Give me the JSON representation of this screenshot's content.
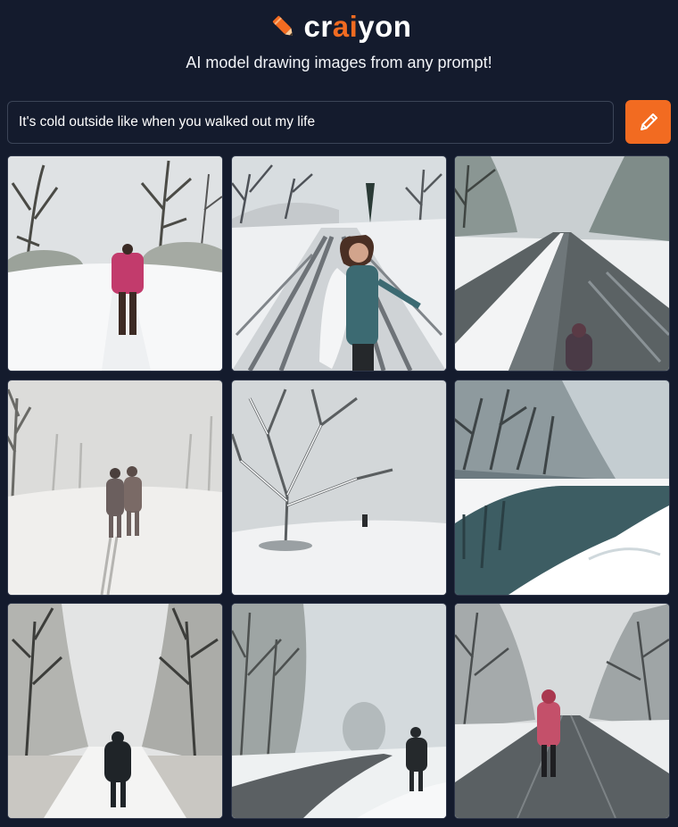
{
  "brand": {
    "name_pre": "cr",
    "name_accent": "ai",
    "name_post": "yon",
    "tagline": "AI model drawing images from any prompt!",
    "accent_color": "#f26b21",
    "logo_icon": "crayon-pencil-icon"
  },
  "prompt": {
    "value": "It's cold outside like when you walked out my life",
    "placeholder": ""
  },
  "draw_button": {
    "icon": "pencil-icon"
  },
  "results": [
    {
      "id": 1,
      "scene": "snowy-path-figure-pink-coat"
    },
    {
      "id": 2,
      "scene": "snowy-road-woman-scarf"
    },
    {
      "id": 3,
      "scene": "foggy-road-snow-figure"
    },
    {
      "id": 4,
      "scene": "foggy-field-two-walkers"
    },
    {
      "id": 5,
      "scene": "snow-tree-small-figure"
    },
    {
      "id": 6,
      "scene": "snowy-river-bank"
    },
    {
      "id": 7,
      "scene": "tree-lined-path-dark-figure"
    },
    {
      "id": 8,
      "scene": "curving-road-walker"
    },
    {
      "id": 9,
      "scene": "wet-road-figure-red-hood"
    }
  ]
}
